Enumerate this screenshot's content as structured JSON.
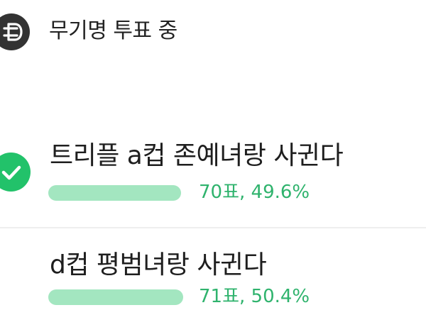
{
  "header": {
    "title": "무기명 투표 중",
    "icon": "vote-icon"
  },
  "poll": {
    "options": [
      {
        "label": "트리플 a컵 존예녀랑 사귄다",
        "votes_text": "70표, 49.6%",
        "votes": 70,
        "percent": 49.6,
        "selected": true,
        "icon": "check-icon"
      },
      {
        "label": "d컵 평범녀랑 사귄다",
        "votes_text": "71표, 50.4%",
        "votes": 71,
        "percent": 50.4,
        "selected": false
      }
    ]
  },
  "colors": {
    "accent": "#22c26a",
    "bar": "#a3e6c0",
    "result_text": "#2fb36d",
    "icon_dark": "#333333"
  }
}
